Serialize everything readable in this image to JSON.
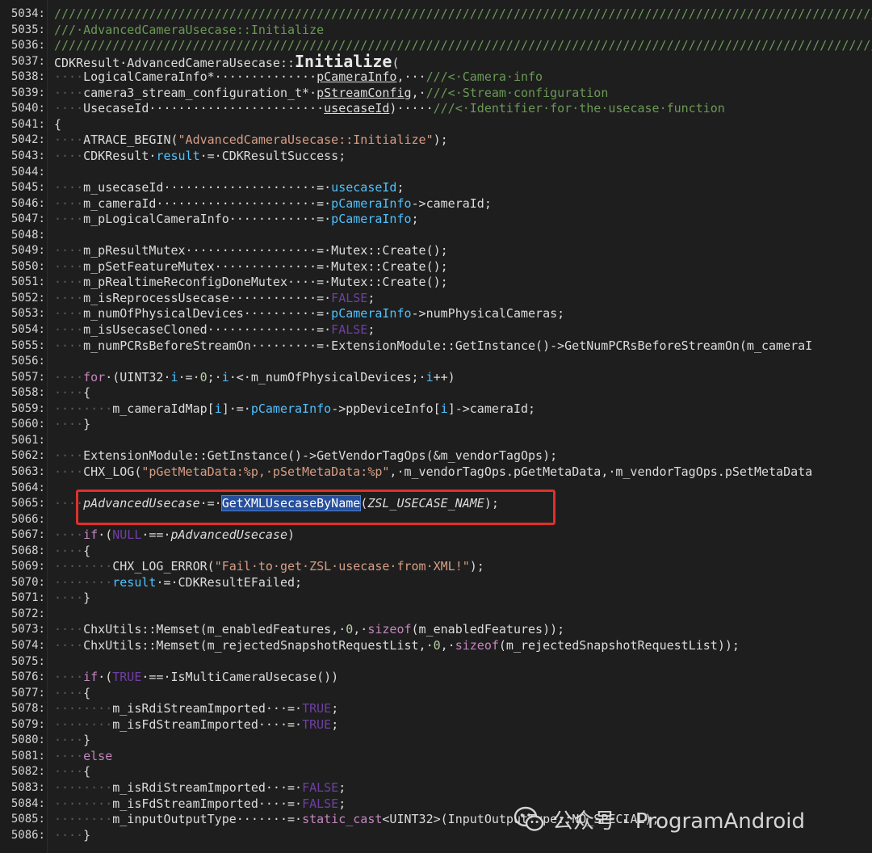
{
  "editor": {
    "lines": [
      {
        "n": "5034:",
        "tokens": [
          {
            "t": "////////////////////////////////////////////////////////////////////////////////////////////////////////////////////",
            "c": "cm"
          }
        ]
      },
      {
        "n": "5035:",
        "tokens": [
          {
            "t": "///·AdvancedCameraUsecase::Initialize",
            "c": "cm"
          }
        ]
      },
      {
        "n": "5036:",
        "tokens": [
          {
            "t": "////////////////////////////////////////////////////////////////////////////////////////////////////////////////////",
            "c": "cm"
          }
        ]
      },
      {
        "n": "5037:",
        "tokens": [
          {
            "t": "CDKResult·AdvancedCameraUsecase::",
            "c": "plain"
          },
          {
            "t": "Initialize",
            "c": "big"
          },
          {
            "t": "(",
            "c": "plain"
          }
        ]
      },
      {
        "n": "5038:",
        "tokens": [
          {
            "t": "····",
            "c": "ws"
          },
          {
            "t": "LogicalCameraInfo*··············",
            "c": "plain"
          },
          {
            "t": "pCameraInfo",
            "c": "param"
          },
          {
            "t": ",···",
            "c": "plain"
          },
          {
            "t": "///<·Camera·info",
            "c": "cm"
          }
        ]
      },
      {
        "n": "5039:",
        "tokens": [
          {
            "t": "····",
            "c": "ws"
          },
          {
            "t": "camera3_stream_configuration_t*·",
            "c": "plain"
          },
          {
            "t": "pStreamConfig",
            "c": "param"
          },
          {
            "t": ",·",
            "c": "plain"
          },
          {
            "t": "///<·Stream·configuration",
            "c": "cm"
          }
        ]
      },
      {
        "n": "5040:",
        "tokens": [
          {
            "t": "····",
            "c": "ws"
          },
          {
            "t": "UsecaseId························",
            "c": "plain"
          },
          {
            "t": "usecaseId",
            "c": "param"
          },
          {
            "t": ")·····",
            "c": "plain"
          },
          {
            "t": "///<·Identifier·for·the·usecase·function",
            "c": "cm"
          }
        ]
      },
      {
        "n": "5041:",
        "tokens": [
          {
            "t": "{",
            "c": "plain"
          }
        ]
      },
      {
        "n": "5042:",
        "tokens": [
          {
            "t": "····",
            "c": "ws"
          },
          {
            "t": "ATRACE_BEGIN(",
            "c": "plain"
          },
          {
            "t": "\"AdvancedCameraUsecase::Initialize\"",
            "c": "str"
          },
          {
            "t": ");",
            "c": "plain"
          }
        ]
      },
      {
        "n": "5043:",
        "tokens": [
          {
            "t": "····",
            "c": "ws"
          },
          {
            "t": "CDKResult·",
            "c": "plain"
          },
          {
            "t": "result",
            "c": "var"
          },
          {
            "t": "·=·CDKResultSuccess;",
            "c": "plain"
          }
        ]
      },
      {
        "n": "5044:",
        "tokens": []
      },
      {
        "n": "5045:",
        "tokens": [
          {
            "t": "····",
            "c": "ws"
          },
          {
            "t": "m_usecaseId·····················=·",
            "c": "plain"
          },
          {
            "t": "usecaseId",
            "c": "var"
          },
          {
            "t": ";",
            "c": "plain"
          }
        ]
      },
      {
        "n": "5046:",
        "tokens": [
          {
            "t": "····",
            "c": "ws"
          },
          {
            "t": "m_cameraId······················=·",
            "c": "plain"
          },
          {
            "t": "pCameraInfo",
            "c": "var"
          },
          {
            "t": "->cameraId;",
            "c": "plain"
          }
        ]
      },
      {
        "n": "5047:",
        "tokens": [
          {
            "t": "····",
            "c": "ws"
          },
          {
            "t": "m_pLogicalCameraInfo············=·",
            "c": "plain"
          },
          {
            "t": "pCameraInfo",
            "c": "var"
          },
          {
            "t": ";",
            "c": "plain"
          }
        ]
      },
      {
        "n": "5048:",
        "tokens": []
      },
      {
        "n": "5049:",
        "tokens": [
          {
            "t": "····",
            "c": "ws"
          },
          {
            "t": "m_pResultMutex··················=·Mutex::Create();",
            "c": "plain"
          }
        ]
      },
      {
        "n": "5050:",
        "tokens": [
          {
            "t": "····",
            "c": "ws"
          },
          {
            "t": "m_pSetFeatureMutex··············=·Mutex::Create();",
            "c": "plain"
          }
        ]
      },
      {
        "n": "5051:",
        "tokens": [
          {
            "t": "····",
            "c": "ws"
          },
          {
            "t": "m_pRealtimeReconfigDoneMutex····=·Mutex::Create();",
            "c": "plain"
          }
        ]
      },
      {
        "n": "5052:",
        "tokens": [
          {
            "t": "····",
            "c": "ws"
          },
          {
            "t": "m_isReprocessUsecase············=·",
            "c": "plain"
          },
          {
            "t": "FALSE",
            "c": "lit"
          },
          {
            "t": ";",
            "c": "plain"
          }
        ]
      },
      {
        "n": "5053:",
        "tokens": [
          {
            "t": "····",
            "c": "ws"
          },
          {
            "t": "m_numOfPhysicalDevices··········=·",
            "c": "plain"
          },
          {
            "t": "pCameraInfo",
            "c": "var"
          },
          {
            "t": "->numPhysicalCameras;",
            "c": "plain"
          }
        ]
      },
      {
        "n": "5054:",
        "tokens": [
          {
            "t": "····",
            "c": "ws"
          },
          {
            "t": "m_isUsecaseCloned···············=·",
            "c": "plain"
          },
          {
            "t": "FALSE",
            "c": "lit"
          },
          {
            "t": ";",
            "c": "plain"
          }
        ]
      },
      {
        "n": "5055:",
        "tokens": [
          {
            "t": "····",
            "c": "ws"
          },
          {
            "t": "m_numPCRsBeforeStreamOn·········=·ExtensionModule::GetInstance()->GetNumPCRsBeforeStreamOn(m_cameraI",
            "c": "plain"
          }
        ]
      },
      {
        "n": "5056:",
        "tokens": []
      },
      {
        "n": "5057:",
        "tokens": [
          {
            "t": "····",
            "c": "ws"
          },
          {
            "t": "for",
            "c": "kw"
          },
          {
            "t": "·(UINT32·",
            "c": "plain"
          },
          {
            "t": "i",
            "c": "var"
          },
          {
            "t": "·=·",
            "c": "plain"
          },
          {
            "t": "0",
            "c": "num"
          },
          {
            "t": ";·",
            "c": "plain"
          },
          {
            "t": "i",
            "c": "var"
          },
          {
            "t": "·<·m_numOfPhysicalDevices;·",
            "c": "plain"
          },
          {
            "t": "i",
            "c": "var"
          },
          {
            "t": "++)",
            "c": "plain"
          }
        ]
      },
      {
        "n": "5058:",
        "tokens": [
          {
            "t": "····",
            "c": "ws"
          },
          {
            "t": "{",
            "c": "plain"
          }
        ]
      },
      {
        "n": "5059:",
        "tokens": [
          {
            "t": "········",
            "c": "ws"
          },
          {
            "t": "m_cameraIdMap[",
            "c": "plain"
          },
          {
            "t": "i",
            "c": "var"
          },
          {
            "t": "]·=·",
            "c": "plain"
          },
          {
            "t": "pCameraInfo",
            "c": "var"
          },
          {
            "t": "->ppDeviceInfo[",
            "c": "plain"
          },
          {
            "t": "i",
            "c": "var"
          },
          {
            "t": "]->cameraId;",
            "c": "plain"
          }
        ]
      },
      {
        "n": "5060:",
        "tokens": [
          {
            "t": "····",
            "c": "ws"
          },
          {
            "t": "}",
            "c": "plain"
          }
        ]
      },
      {
        "n": "5061:",
        "tokens": []
      },
      {
        "n": "5062:",
        "tokens": [
          {
            "t": "····",
            "c": "ws"
          },
          {
            "t": "ExtensionModule::GetInstance()->GetVendorTagOps(&m_vendorTagOps);",
            "c": "plain"
          }
        ]
      },
      {
        "n": "5063:",
        "tokens": [
          {
            "t": "····",
            "c": "ws"
          },
          {
            "t": "CHX_LOG(",
            "c": "plain"
          },
          {
            "t": "\"pGetMetaData:%p,·pSetMetaData:%p\"",
            "c": "str"
          },
          {
            "t": ",·m_vendorTagOps.pGetMetaData,·m_vendorTagOps.pSetMetaData",
            "c": "plain"
          }
        ]
      },
      {
        "n": "5064:",
        "tokens": []
      },
      {
        "n": "5065:",
        "tokens": [
          {
            "t": "····",
            "c": "ws"
          },
          {
            "t": "pAdvancedUsecase",
            "c": "italic"
          },
          {
            "t": "·=·",
            "c": "plain"
          },
          {
            "t": "GetXMLUsecaseByName",
            "c": "sel"
          },
          {
            "t": "(",
            "c": "plain"
          },
          {
            "t": "ZSL_USECASE_NAME",
            "c": "italic"
          },
          {
            "t": ");",
            "c": "plain"
          }
        ]
      },
      {
        "n": "5066:",
        "tokens": []
      },
      {
        "n": "5067:",
        "tokens": [
          {
            "t": "····",
            "c": "ws"
          },
          {
            "t": "if",
            "c": "kw"
          },
          {
            "t": "·(",
            "c": "plain"
          },
          {
            "t": "NULL",
            "c": "lit"
          },
          {
            "t": "·==·",
            "c": "plain"
          },
          {
            "t": "pAdvancedUsecase",
            "c": "italic"
          },
          {
            "t": ")",
            "c": "plain"
          }
        ]
      },
      {
        "n": "5068:",
        "tokens": [
          {
            "t": "····",
            "c": "ws"
          },
          {
            "t": "{",
            "c": "plain"
          }
        ]
      },
      {
        "n": "5069:",
        "tokens": [
          {
            "t": "········",
            "c": "ws"
          },
          {
            "t": "CHX_LOG_ERROR(",
            "c": "plain"
          },
          {
            "t": "\"Fail·to·get·ZSL·usecase·from·XML!\"",
            "c": "str"
          },
          {
            "t": ");",
            "c": "plain"
          }
        ]
      },
      {
        "n": "5070:",
        "tokens": [
          {
            "t": "········",
            "c": "ws"
          },
          {
            "t": "result",
            "c": "var"
          },
          {
            "t": "·=·CDKResultEFailed;",
            "c": "plain"
          }
        ]
      },
      {
        "n": "5071:",
        "tokens": [
          {
            "t": "····",
            "c": "ws"
          },
          {
            "t": "}",
            "c": "plain"
          }
        ]
      },
      {
        "n": "5072:",
        "tokens": []
      },
      {
        "n": "5073:",
        "tokens": [
          {
            "t": "····",
            "c": "ws"
          },
          {
            "t": "ChxUtils::Memset(m_enabledFeatures,·",
            "c": "plain"
          },
          {
            "t": "0",
            "c": "num"
          },
          {
            "t": ",·",
            "c": "plain"
          },
          {
            "t": "sizeof",
            "c": "kw"
          },
          {
            "t": "(m_enabledFeatures));",
            "c": "plain"
          }
        ]
      },
      {
        "n": "5074:",
        "tokens": [
          {
            "t": "····",
            "c": "ws"
          },
          {
            "t": "ChxUtils::Memset(m_rejectedSnapshotRequestList,·",
            "c": "plain"
          },
          {
            "t": "0",
            "c": "num"
          },
          {
            "t": ",·",
            "c": "plain"
          },
          {
            "t": "sizeof",
            "c": "kw"
          },
          {
            "t": "(m_rejectedSnapshotRequestList));",
            "c": "plain"
          }
        ]
      },
      {
        "n": "5075:",
        "tokens": []
      },
      {
        "n": "5076:",
        "tokens": [
          {
            "t": "····",
            "c": "ws"
          },
          {
            "t": "if",
            "c": "kw"
          },
          {
            "t": "·(",
            "c": "plain"
          },
          {
            "t": "TRUE",
            "c": "lit"
          },
          {
            "t": "·==·IsMultiCameraUsecase())",
            "c": "plain"
          }
        ]
      },
      {
        "n": "5077:",
        "tokens": [
          {
            "t": "····",
            "c": "ws"
          },
          {
            "t": "{",
            "c": "plain"
          }
        ]
      },
      {
        "n": "5078:",
        "tokens": [
          {
            "t": "········",
            "c": "ws"
          },
          {
            "t": "m_isRdiStreamImported···=·",
            "c": "plain"
          },
          {
            "t": "TRUE",
            "c": "lit"
          },
          {
            "t": ";",
            "c": "plain"
          }
        ]
      },
      {
        "n": "5079:",
        "tokens": [
          {
            "t": "········",
            "c": "ws"
          },
          {
            "t": "m_isFdStreamImported····=·",
            "c": "plain"
          },
          {
            "t": "TRUE",
            "c": "lit"
          },
          {
            "t": ";",
            "c": "plain"
          }
        ]
      },
      {
        "n": "5080:",
        "tokens": [
          {
            "t": "····",
            "c": "ws"
          },
          {
            "t": "}",
            "c": "plain"
          }
        ]
      },
      {
        "n": "5081:",
        "tokens": [
          {
            "t": "····",
            "c": "ws"
          },
          {
            "t": "else",
            "c": "kw"
          }
        ]
      },
      {
        "n": "5082:",
        "tokens": [
          {
            "t": "····",
            "c": "ws"
          },
          {
            "t": "{",
            "c": "plain"
          }
        ]
      },
      {
        "n": "5083:",
        "tokens": [
          {
            "t": "········",
            "c": "ws"
          },
          {
            "t": "m_isRdiStreamImported···=·",
            "c": "plain"
          },
          {
            "t": "FALSE",
            "c": "lit"
          },
          {
            "t": ";",
            "c": "plain"
          }
        ]
      },
      {
        "n": "5084:",
        "tokens": [
          {
            "t": "········",
            "c": "ws"
          },
          {
            "t": "m_isFdStreamImported····=·",
            "c": "plain"
          },
          {
            "t": "FALSE",
            "c": "lit"
          },
          {
            "t": ";",
            "c": "plain"
          }
        ]
      },
      {
        "n": "5085:",
        "tokens": [
          {
            "t": "········",
            "c": "ws"
          },
          {
            "t": "m_inputOutputType·······=·",
            "c": "plain"
          },
          {
            "t": "static_cast",
            "c": "kw"
          },
          {
            "t": "<UINT32>(InputOutputType::NO_SPECIAL);",
            "c": "plain"
          }
        ]
      },
      {
        "n": "5086:",
        "tokens": [
          {
            "t": "····",
            "c": "ws"
          },
          {
            "t": "}",
            "c": "plain"
          }
        ]
      }
    ]
  },
  "watermark": {
    "text": "公众号 · ProgramAndroid",
    "icon": "wechat-icon"
  },
  "colors": {
    "background": "#1e1e1e",
    "highlight_border": "#e0302a",
    "selection": "#264f9c"
  }
}
